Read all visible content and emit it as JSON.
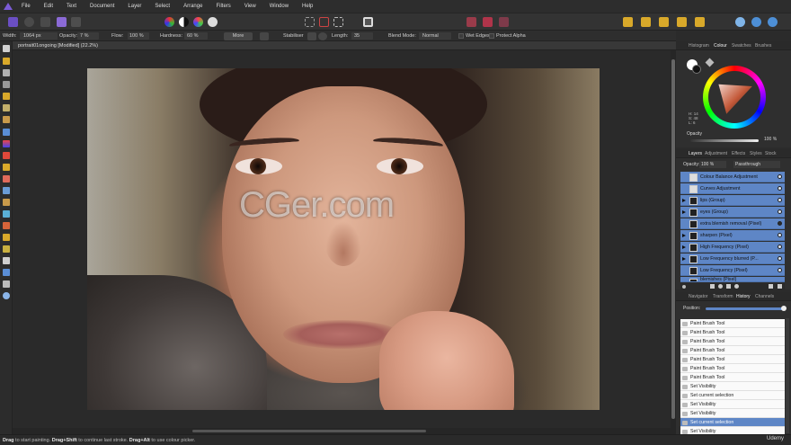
{
  "menu": [
    "File",
    "Edit",
    "Text",
    "Document",
    "Layer",
    "Select",
    "Arrange",
    "Filters",
    "View",
    "Window",
    "Help"
  ],
  "context_bar": {
    "width_label": "Width:",
    "width_value": "1064 px",
    "opacity_label": "Opacity:",
    "opacity_value": "7 %",
    "flow_label": "Flow:",
    "flow_value": "100 %",
    "hardness_label": "Hardness:",
    "hardness_value": "60 %",
    "more_label": "More",
    "stabiliser_label": "Stabiliser",
    "length_label": "Length:",
    "length_value": "35",
    "blend_label": "Blend Mode:",
    "blend_value": "Normal",
    "wet_edges_label": "Wet Edges",
    "protect_alpha_label": "Protect Alpha"
  },
  "document": {
    "tab_title": "portrait01ongoing [Modified] (22.2%)"
  },
  "watermark": "CGer.com",
  "colour_panel": {
    "tabs": [
      "Histogram",
      "Colour",
      "Swatches",
      "Brushes"
    ],
    "active_tab": "Colour",
    "readout": [
      "H: 14",
      "S: 48",
      "L: 6"
    ],
    "opacity_label": "Opacity",
    "opacity_value": "100 %"
  },
  "layers_panel": {
    "tabs": [
      "Layers",
      "Adjustment",
      "Effects",
      "Styles",
      "Stock"
    ],
    "active_tab": "Layers",
    "opacity_label": "Opacity:",
    "opacity_value": "100 %",
    "blend_value": "Passthrough",
    "layers": [
      {
        "name": "Colour Balance Adjustment",
        "expandable": false
      },
      {
        "name": "Curves Adjustment",
        "expandable": false
      },
      {
        "name": "lips (Group)",
        "expandable": true
      },
      {
        "name": "eyes (Group)",
        "expandable": true
      },
      {
        "name": "extra blemish removal (Pixel)",
        "expandable": false
      },
      {
        "name": "sharpen (Pixel)",
        "expandable": true
      },
      {
        "name": "High Frequency (Pixel)",
        "expandable": true
      },
      {
        "name": "Low Frequency blurred (P...",
        "expandable": true
      },
      {
        "name": "Low Frequency (Pixel)",
        "expandable": false
      },
      {
        "name": "blemishes (Pixel)",
        "expandable": false
      }
    ]
  },
  "history_panel": {
    "tabs": [
      "Navigator",
      "Transform",
      "History",
      "Channels"
    ],
    "active_tab": "History",
    "position_label": "Position:",
    "items": [
      {
        "label": "Paint Brush Tool",
        "selected": false
      },
      {
        "label": "Paint Brush Tool",
        "selected": false
      },
      {
        "label": "Paint Brush Tool",
        "selected": false
      },
      {
        "label": "Paint Brush Tool",
        "selected": false
      },
      {
        "label": "Paint Brush Tool",
        "selected": false
      },
      {
        "label": "Paint Brush Tool",
        "selected": false
      },
      {
        "label": "Paint Brush Tool",
        "selected": false
      },
      {
        "label": "Set Visibility",
        "selected": false
      },
      {
        "label": "Set current selection",
        "selected": false
      },
      {
        "label": "Set Visibility",
        "selected": false
      },
      {
        "label": "Set Visibility",
        "selected": false
      },
      {
        "label": "Set current selection",
        "selected": true
      },
      {
        "label": "Set Visibility",
        "selected": false
      }
    ]
  },
  "status_bar": {
    "a": "Drag",
    "a_text": " to start painting. ",
    "b": "Drag+Shift",
    "b_text": " to continue last stroke. ",
    "c": "Drag+Alt",
    "c_text": " to use colour picker.",
    "brand": "Udemy"
  },
  "colors": {
    "accent": "#5e86c6",
    "app_bg": "#2b2b2b",
    "logo": "#7b5bd6"
  }
}
